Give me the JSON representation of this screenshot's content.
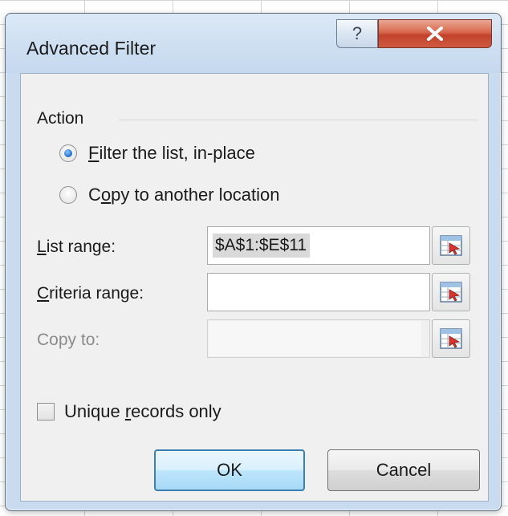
{
  "dialog": {
    "title": "Advanced Filter",
    "help_glyph": "?",
    "close_icon": "close-icon"
  },
  "action": {
    "group_label": "Action",
    "options": [
      {
        "prefix": "",
        "accel": "F",
        "suffix": "ilter the list, in-place",
        "checked": true
      },
      {
        "prefix": "C",
        "accel": "o",
        "suffix": "py to another location",
        "checked": false
      }
    ]
  },
  "fields": {
    "list_range": {
      "accel": "L",
      "label_rest": "ist range:",
      "value": "$A$1:$E$11",
      "enabled": true
    },
    "criteria_range": {
      "accel": "C",
      "label_rest": "riteria range:",
      "value": "",
      "enabled": true
    },
    "copy_to": {
      "label": "Copy to:",
      "value": "",
      "enabled": false
    }
  },
  "unique": {
    "prefix": "Unique ",
    "accel": "r",
    "suffix": "ecords only",
    "checked": false
  },
  "buttons": {
    "ok": "OK",
    "cancel": "Cancel"
  },
  "icons": {
    "range_picker": "collapse-dialog-icon"
  }
}
